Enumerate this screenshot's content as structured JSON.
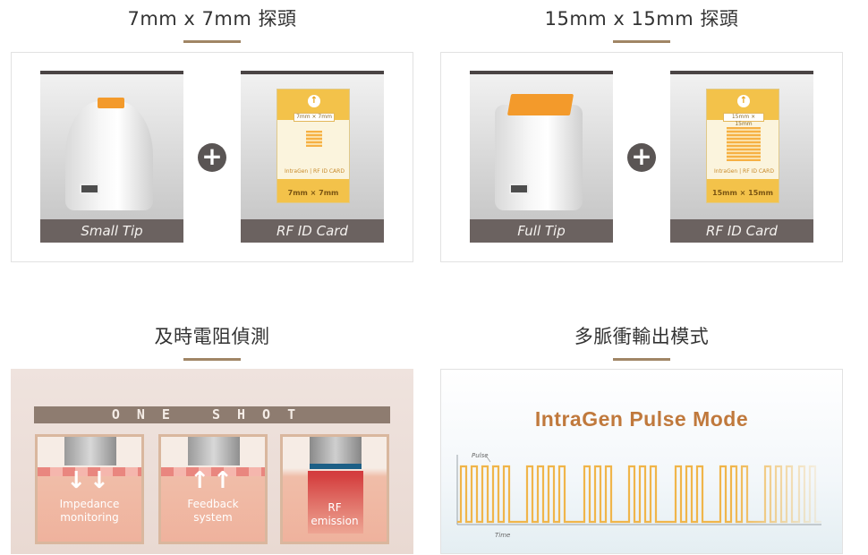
{
  "sections": {
    "tip7": {
      "title": "7mm x 7mm 探頭",
      "tip_caption": "Small Tip",
      "card_caption": "RF ID Card",
      "card_size": "7mm × 7mm",
      "card_brand": "IntraGen | RF ID CARD"
    },
    "tip15": {
      "title": "15mm x 15mm 探頭",
      "tip_caption": "Full Tip",
      "card_caption": "RF ID Card",
      "card_size": "15mm × 15mm",
      "card_brand": "IntraGen | RF ID CARD"
    },
    "impedance": {
      "title": "及時電阻偵測",
      "header": "ONE SHOT",
      "steps": [
        {
          "label_line1": "Impedance",
          "label_line2": "monitoring",
          "arrows": "↓↓"
        },
        {
          "label_line1": "Feedback",
          "label_line2": "system",
          "arrows": "↑↑"
        },
        {
          "label_line1": "RF",
          "label_line2": "emission",
          "arrows": ""
        }
      ]
    },
    "pulse": {
      "title": "多脈衝輸出模式",
      "graphic_title": "IntraGen Pulse Mode",
      "axis_y": "Pulse",
      "axis_x": "Time"
    }
  },
  "plus_symbol": "+",
  "colors": {
    "accent_bar": "#a08565",
    "caption_bg": "#6b6260",
    "tip_orange": "#f39a2b",
    "card_yellow": "#f3c24a",
    "pulse_line": "#f0b54a",
    "pulse_title": "#c0793c"
  },
  "icons": {
    "plus": "plus-circle-icon",
    "arrow_up": "arrow-up-icon"
  }
}
